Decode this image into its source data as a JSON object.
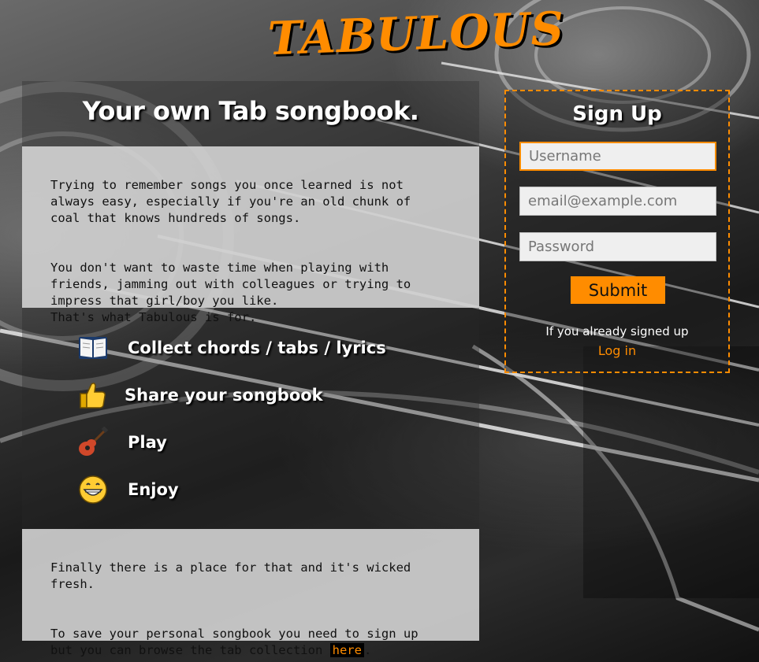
{
  "logo": {
    "text": "TABULOUS",
    "color": "#ff8c00"
  },
  "hero": {
    "tagline": "Your own Tab songbook."
  },
  "intro": {
    "paragraph1": "Trying to remember songs you once learned is not\nalways easy, especially if you're an old chunk of\ncoal that knows hundreds of songs.",
    "paragraph2": "You don't want to waste time when playing with\nfriends, jamming out with colleagues or trying to\nimpress that girl/boy you like.\nThat's what Tabulous is for."
  },
  "features": [
    {
      "icon": "book-icon",
      "label": "Collect chords / tabs / lyrics"
    },
    {
      "icon": "thumbs-up-icon",
      "label": "Share your songbook"
    },
    {
      "icon": "guitar-icon",
      "label": "Play"
    },
    {
      "icon": "grin-icon",
      "label": "Enjoy"
    }
  ],
  "outro": {
    "paragraph1": "Finally there is a place for that and it's wicked\nfresh.",
    "paragraph2_before": "To save your personal songbook you need to sign up\nbut you can browse the tab collection ",
    "link_label": "here",
    "paragraph2_after": "."
  },
  "signup": {
    "title": "Sign Up",
    "username_placeholder": "Username",
    "email_placeholder": "email@example.com",
    "password_placeholder": "Password",
    "submit_label": "Submit",
    "already_text": "If you already signed up",
    "login_label": "Log in"
  },
  "colors": {
    "accent": "#ff8c00"
  }
}
